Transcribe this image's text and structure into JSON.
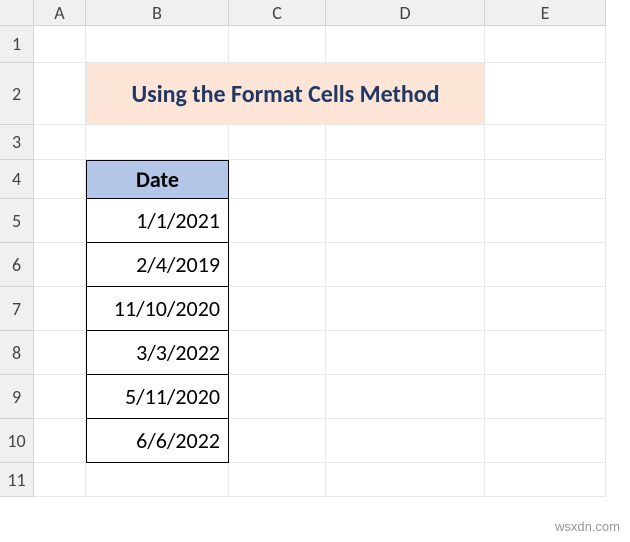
{
  "columns": [
    "A",
    "B",
    "C",
    "D",
    "E"
  ],
  "rows": [
    "1",
    "2",
    "3",
    "4",
    "5",
    "6",
    "7",
    "8",
    "9",
    "10",
    "11"
  ],
  "title": "Using the Format Cells Method",
  "table": {
    "header": "Date",
    "values": [
      "1/1/2021",
      "2/4/2019",
      "11/10/2020",
      "3/3/2022",
      "5/11/2020",
      "6/6/2022"
    ]
  },
  "watermark": "wsxdn.com"
}
